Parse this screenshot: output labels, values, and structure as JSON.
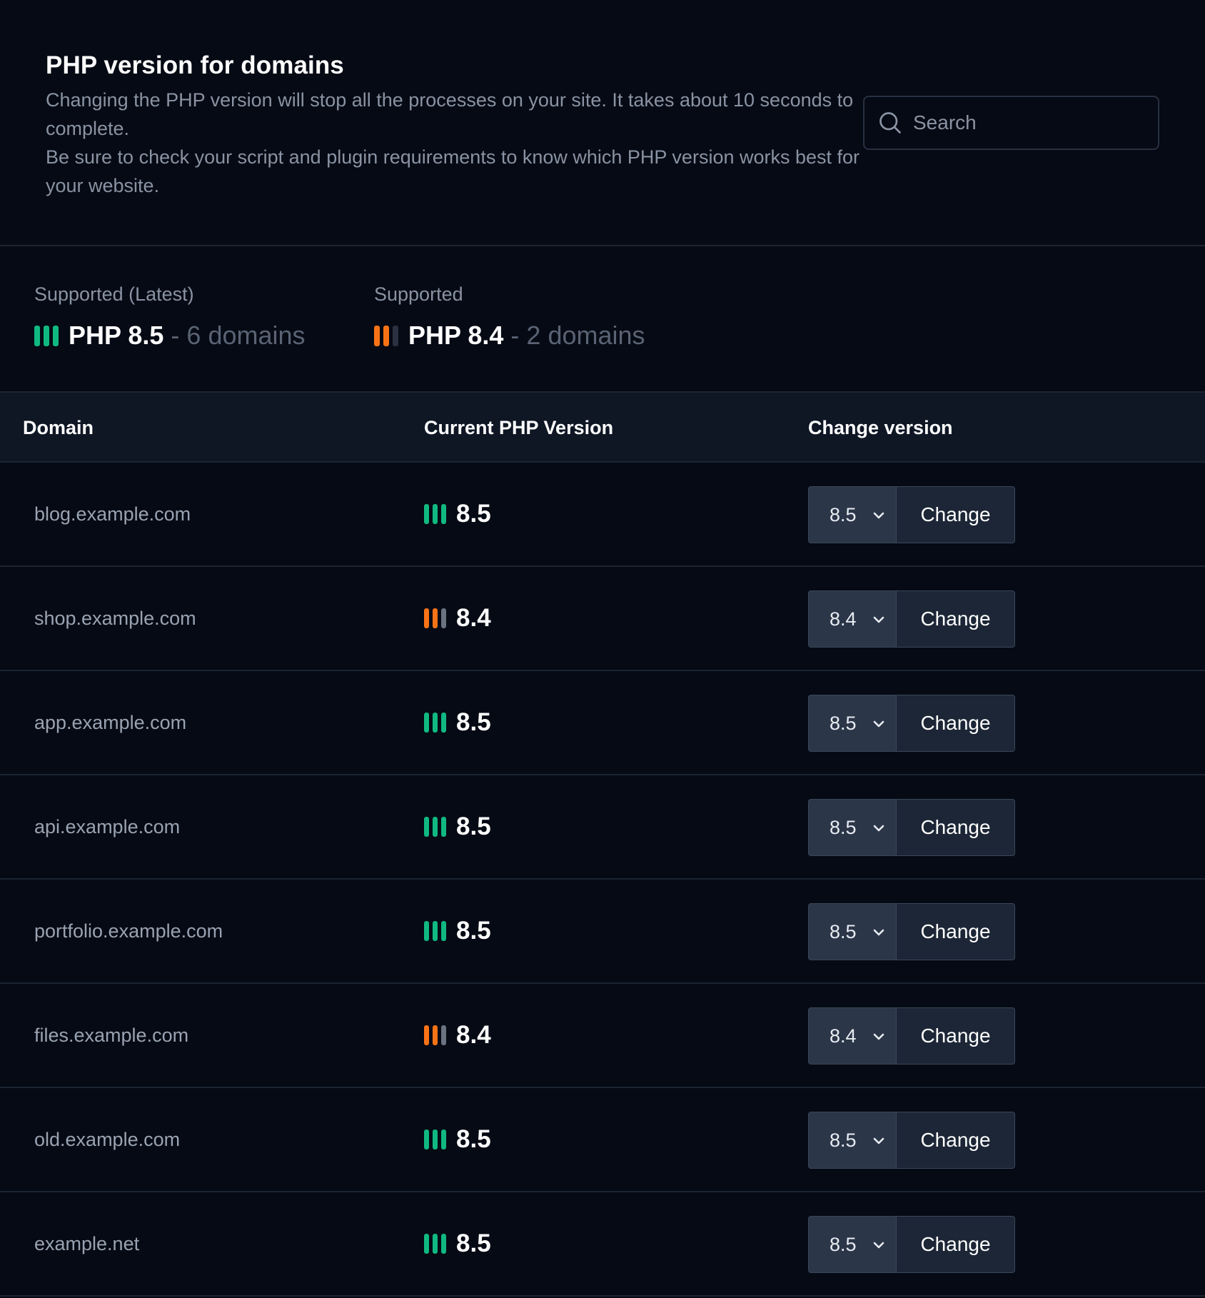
{
  "header": {
    "title": "PHP version for domains",
    "description_line1": "Changing the PHP version will stop all the processes on your site. It takes about 10 seconds to complete.",
    "description_line2": "Be sure to check your script and plugin requirements to know which PHP version works best for your website."
  },
  "search": {
    "placeholder": "Search",
    "value": ""
  },
  "summary": [
    {
      "label": "Supported (Latest)",
      "version": "PHP 8.5",
      "separator": "-",
      "count": "6 domains",
      "bars": [
        "green",
        "green",
        "green"
      ]
    },
    {
      "label": "Supported",
      "version": "PHP 8.4",
      "separator": "-",
      "count": "2 domains",
      "bars": [
        "orange",
        "orange",
        "dark"
      ]
    }
  ],
  "table": {
    "columns": [
      "Domain",
      "Current PHP Version",
      "Change version"
    ],
    "change_label": "Change",
    "rows": [
      {
        "domain": "blog.example.com",
        "version": "8.5",
        "status": "latest",
        "selected": "8.5"
      },
      {
        "domain": "shop.example.com",
        "version": "8.4",
        "status": "supported",
        "selected": "8.4"
      },
      {
        "domain": "app.example.com",
        "version": "8.5",
        "status": "latest",
        "selected": "8.5"
      },
      {
        "domain": "api.example.com",
        "version": "8.5",
        "status": "latest",
        "selected": "8.5"
      },
      {
        "domain": "portfolio.example.com",
        "version": "8.5",
        "status": "latest",
        "selected": "8.5"
      },
      {
        "domain": "files.example.com",
        "version": "8.4",
        "status": "supported",
        "selected": "8.4"
      },
      {
        "domain": "old.example.com",
        "version": "8.5",
        "status": "latest",
        "selected": "8.5"
      },
      {
        "domain": "example.net",
        "version": "8.5",
        "status": "latest",
        "selected": "8.5"
      }
    ]
  },
  "icons": {
    "search": "search-icon",
    "select": "chevron-down-icon",
    "status": "version-bars-icon"
  },
  "colors": {
    "background": "#050a14",
    "header_row": "#0f1725",
    "latest": "#10b981",
    "supported": "#f97316",
    "muted_bar": "#6b7280"
  }
}
